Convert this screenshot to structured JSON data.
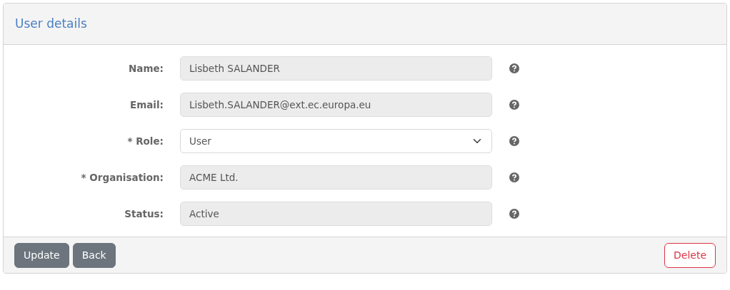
{
  "title": "User details",
  "fields": [
    {
      "label": "Name:",
      "kind": "text",
      "value": "Lisbeth SALANDER",
      "disabled": true
    },
    {
      "label": "Email:",
      "kind": "text",
      "value": "Lisbeth.SALANDER@ext.ec.europa.eu",
      "disabled": true
    },
    {
      "label": "* Role:",
      "kind": "select",
      "value": "User",
      "disabled": false
    },
    {
      "label": "* Organisation:",
      "kind": "text",
      "value": "ACME Ltd.",
      "disabled": true
    },
    {
      "label": "Status:",
      "kind": "text",
      "value": "Active",
      "disabled": true
    }
  ],
  "buttons": [
    {
      "label": "Update",
      "kind": "secondary"
    },
    {
      "label": "Back",
      "kind": "secondary"
    },
    {
      "label": "Delete",
      "kind": "danger"
    }
  ]
}
